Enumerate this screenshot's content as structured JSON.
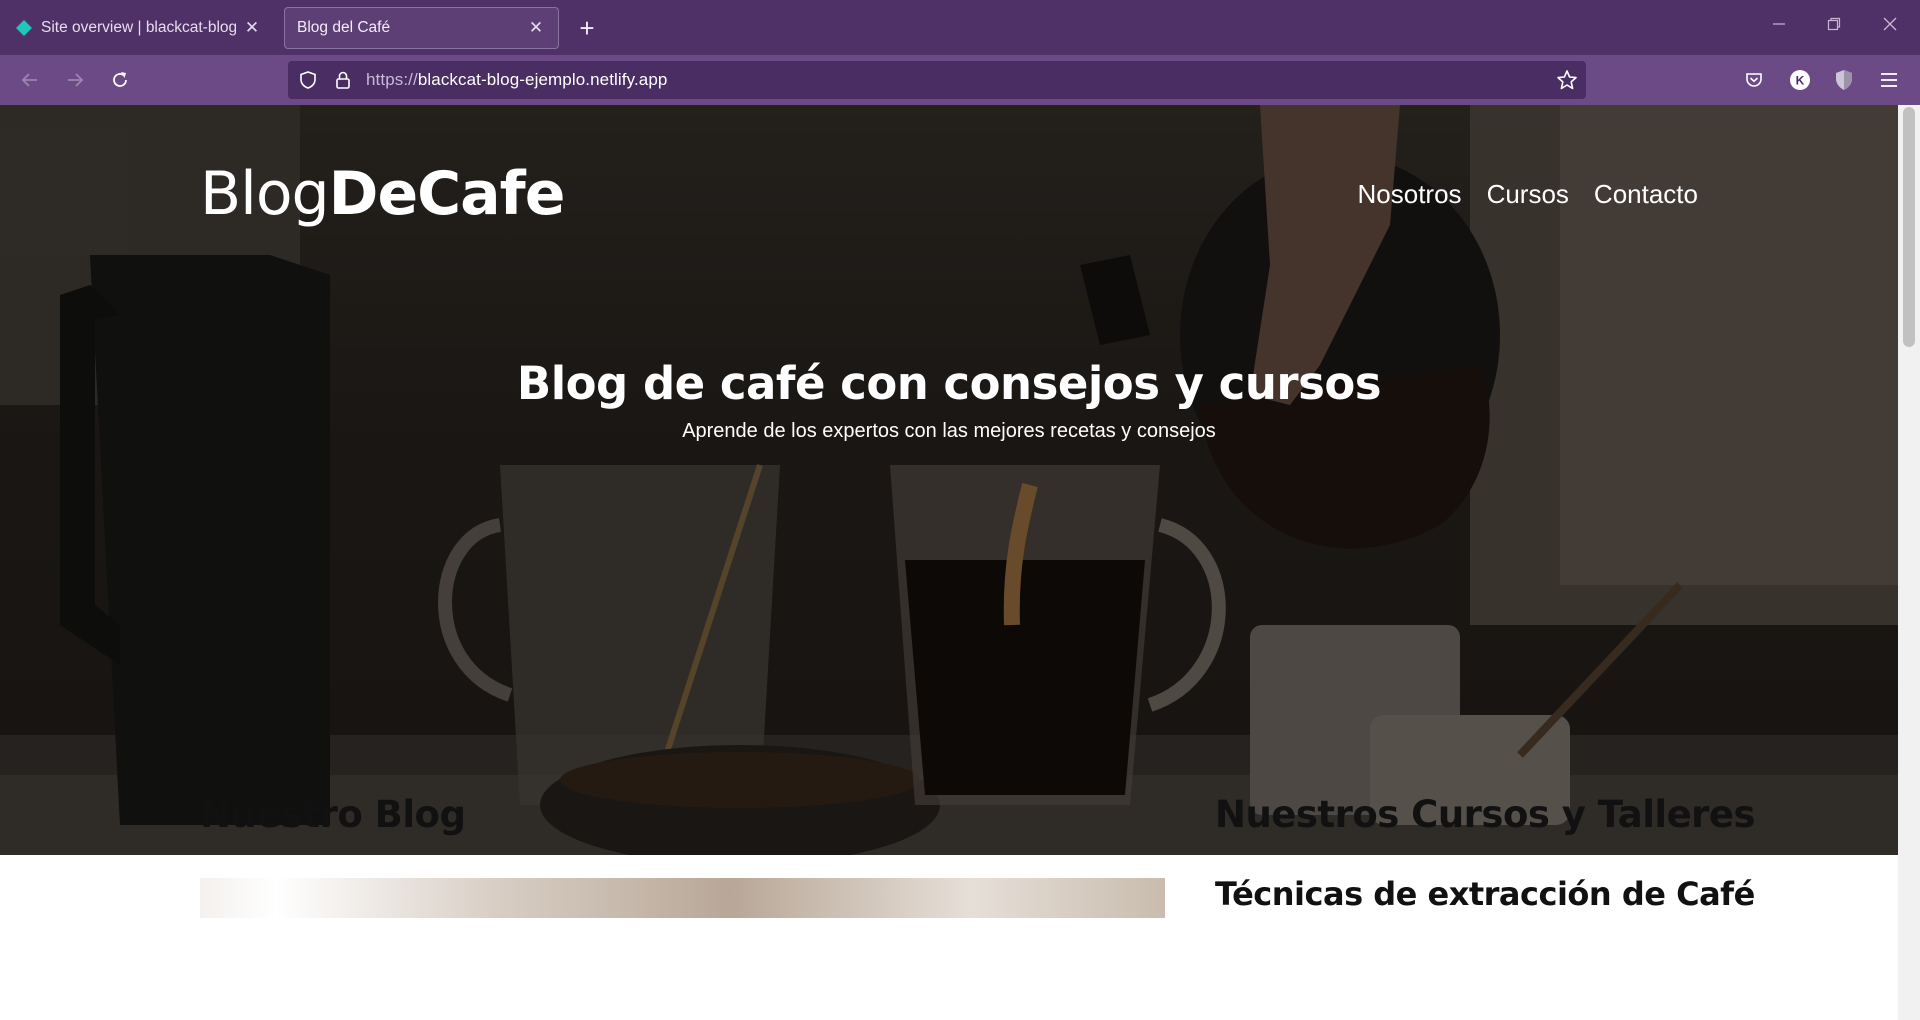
{
  "browser": {
    "tabs": [
      {
        "title": "Site overview | blackcat-blog-ejemplo",
        "active": false,
        "favicon": "netlify-diamond-icon"
      },
      {
        "title": "Blog del Café",
        "active": true
      }
    ],
    "new_tab": "+",
    "url_scheme": "https://",
    "url_host": "blackcat-blog-ejemplo.netlify.app",
    "account_initial": "K",
    "colors": {
      "tabbar": "#4f3167",
      "toolbar": "#6c4a86",
      "urlbar": "#4a2d62"
    }
  },
  "site": {
    "logo_regular": "Blog",
    "logo_bold": "DeCafe",
    "nav": [
      "Nosotros",
      "Cursos",
      "Contacto"
    ],
    "hero_title": "Blog de café con consejos y cursos",
    "hero_subtitle": "Aprende de los expertos con las mejores recetas y consejos",
    "blog_heading": "Nuestro Blog",
    "courses_heading": "Nuestros Cursos y Talleres",
    "first_course_title": "Técnicas de extracción de Café"
  }
}
